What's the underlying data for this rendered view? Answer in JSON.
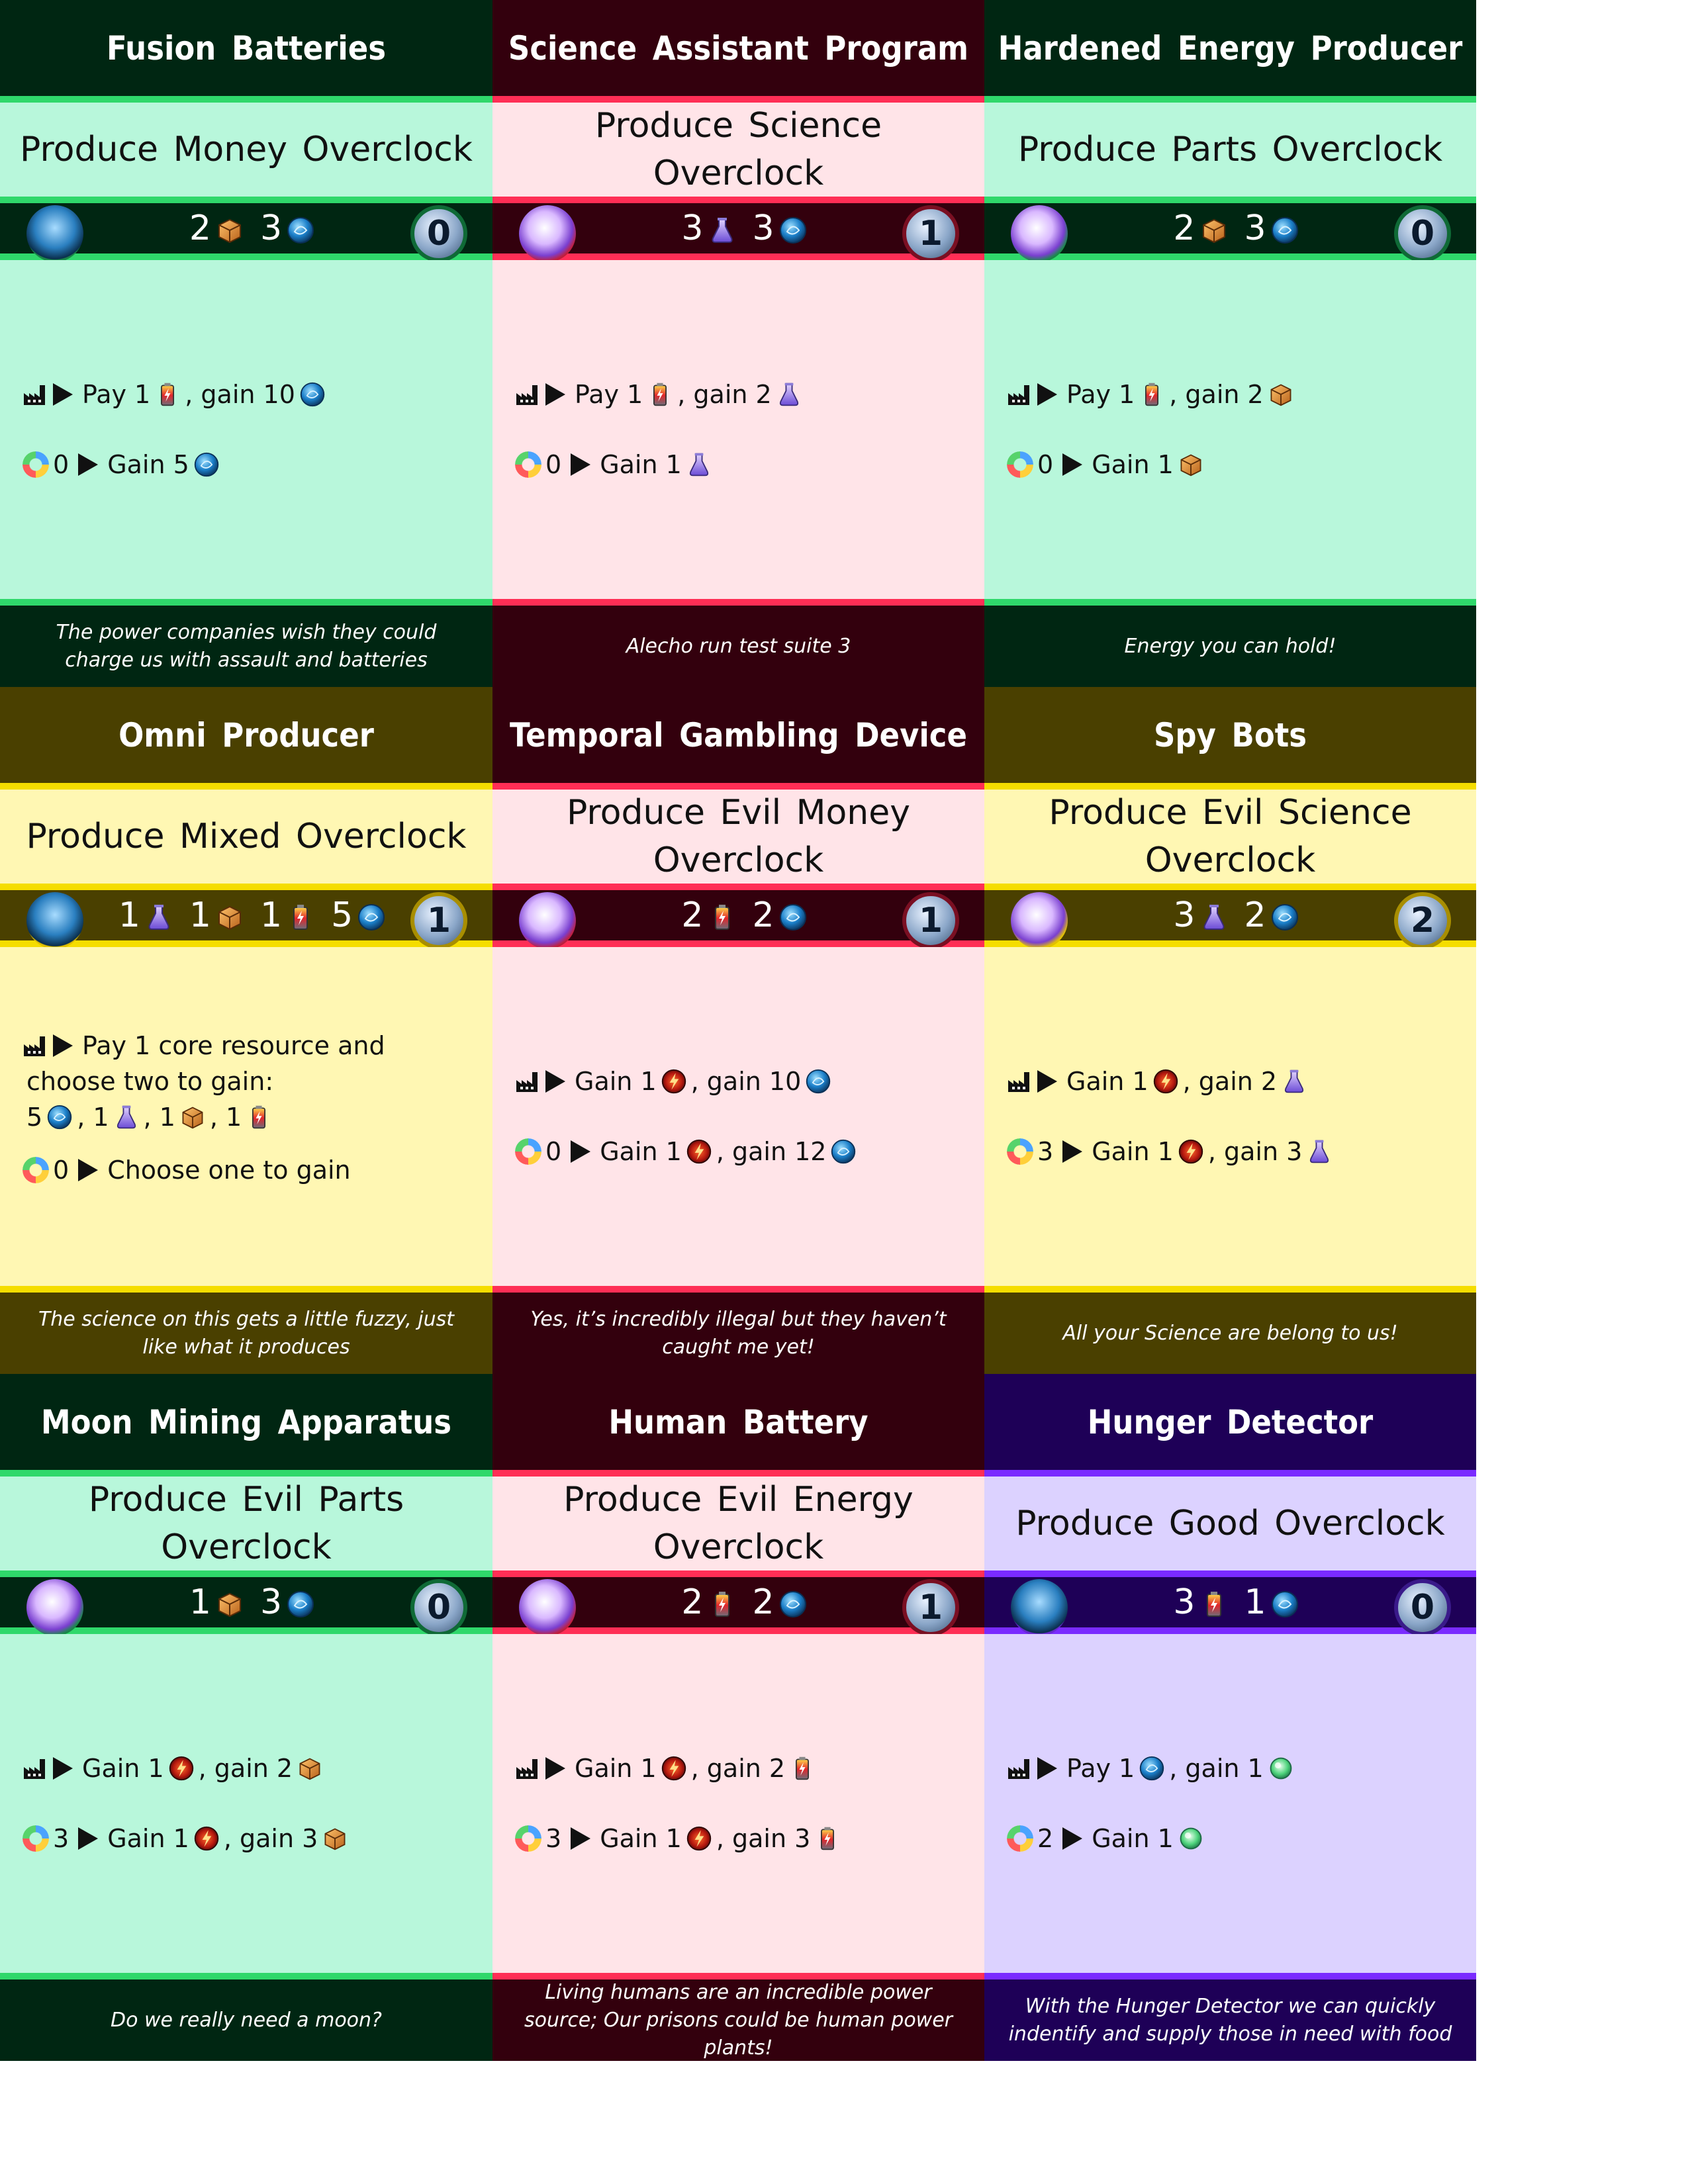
{
  "cards": [
    {
      "theme": "green",
      "title": "Fusion Batteries",
      "subtitle": "Produce Money Overclock",
      "portrait": "robot-portrait",
      "cost": [
        {
          "n": "2",
          "icon": "parts"
        },
        {
          "n": "3",
          "icon": "money"
        }
      ],
      "badge": "0",
      "lines": [
        [
          {
            "t": "factory"
          },
          {
            "t": "arrow"
          },
          {
            "s": "Pay 1"
          },
          {
            "t": "energy"
          },
          {
            "s": ", gain 10"
          },
          {
            "t": "money"
          }
        ],
        [
          {
            "t": "cycle"
          },
          {
            "s": "0"
          },
          {
            "t": "arrow"
          },
          {
            "s": "Gain 5"
          },
          {
            "t": "money"
          }
        ]
      ],
      "flavor": "The power companies wish they could charge us with assault and batteries"
    },
    {
      "theme": "red",
      "title": "Science Assistant Program",
      "subtitle": "Produce Science Overclock",
      "portrait": "cube-portrait",
      "cost": [
        {
          "n": "3",
          "icon": "science"
        },
        {
          "n": "3",
          "icon": "money"
        }
      ],
      "badge": "1",
      "lines": [
        [
          {
            "t": "factory"
          },
          {
            "t": "arrow"
          },
          {
            "s": "Pay 1"
          },
          {
            "t": "energy"
          },
          {
            "s": ", gain 2"
          },
          {
            "t": "science"
          }
        ],
        [
          {
            "t": "cycle"
          },
          {
            "s": "0"
          },
          {
            "t": "arrow"
          },
          {
            "s": "Gain 1"
          },
          {
            "t": "science"
          }
        ]
      ],
      "flavor": "Alecho run test suite 3"
    },
    {
      "theme": "green",
      "title": "Hardened Energy Producer",
      "subtitle": "Produce Parts Overclock",
      "portrait": "cube-portrait",
      "cost": [
        {
          "n": "2",
          "icon": "parts"
        },
        {
          "n": "3",
          "icon": "money"
        }
      ],
      "badge": "0",
      "lines": [
        [
          {
            "t": "factory"
          },
          {
            "t": "arrow"
          },
          {
            "s": "Pay 1"
          },
          {
            "t": "energy"
          },
          {
            "s": ", gain 2"
          },
          {
            "t": "parts"
          }
        ],
        [
          {
            "t": "cycle"
          },
          {
            "s": "0"
          },
          {
            "t": "arrow"
          },
          {
            "s": "Gain 1"
          },
          {
            "t": "parts"
          }
        ]
      ],
      "flavor": "Energy you can hold!"
    },
    {
      "theme": "yellow",
      "title": "Omni Producer",
      "subtitle": "Produce Mixed Overclock",
      "portrait": "robot-portrait",
      "cost": [
        {
          "n": "1",
          "icon": "science"
        },
        {
          "n": "1",
          "icon": "parts"
        },
        {
          "n": "1",
          "icon": "energy"
        },
        {
          "n": "5",
          "icon": "money"
        }
      ],
      "badge": "1",
      "lines": [
        [
          {
            "t": "factory"
          },
          {
            "t": "arrow"
          },
          {
            "s": "Pay 1 core resource and"
          }
        ],
        [
          {
            "s": "choose two to gain:"
          }
        ],
        [
          {
            "s": "5"
          },
          {
            "t": "money"
          },
          {
            "s": ", 1"
          },
          {
            "t": "science"
          },
          {
            "s": ", 1"
          },
          {
            "t": "parts"
          },
          {
            "s": ", 1"
          },
          {
            "t": "energy"
          }
        ],
        [
          {
            "t": "cycle"
          },
          {
            "s": "0"
          },
          {
            "t": "arrow"
          },
          {
            "s": "Choose one to gain"
          }
        ]
      ],
      "flavor": "The science on this gets a little fuzzy, just like what it produces"
    },
    {
      "theme": "red",
      "title": "Temporal Gambling Device",
      "subtitle": "Produce Evil Money Overclock",
      "portrait": "cube-portrait",
      "cost": [
        {
          "n": "2",
          "icon": "energy"
        },
        {
          "n": "2",
          "icon": "money"
        }
      ],
      "badge": "1",
      "lines": [
        [
          {
            "t": "factory"
          },
          {
            "t": "arrow"
          },
          {
            "s": "Gain 1"
          },
          {
            "t": "evil"
          },
          {
            "s": ", gain 10"
          },
          {
            "t": "money"
          }
        ],
        [
          {
            "t": "cycle"
          },
          {
            "s": "0"
          },
          {
            "t": "arrow"
          },
          {
            "s": "Gain 1"
          },
          {
            "t": "evil"
          },
          {
            "s": ", gain 12"
          },
          {
            "t": "money"
          }
        ]
      ],
      "flavor": "Yes, it’s incredibly illegal but they haven’t caught me yet!"
    },
    {
      "theme": "yellow",
      "title": "Spy Bots",
      "subtitle": "Produce Evil Science Overclock",
      "portrait": "cube-portrait",
      "cost": [
        {
          "n": "3",
          "icon": "science"
        },
        {
          "n": "2",
          "icon": "money"
        }
      ],
      "badge": "2",
      "lines": [
        [
          {
            "t": "factory"
          },
          {
            "t": "arrow"
          },
          {
            "s": "Gain 1"
          },
          {
            "t": "evil"
          },
          {
            "s": ", gain 2"
          },
          {
            "t": "science"
          }
        ],
        [
          {
            "t": "cycle"
          },
          {
            "s": "3"
          },
          {
            "t": "arrow"
          },
          {
            "s": "Gain 1"
          },
          {
            "t": "evil"
          },
          {
            "s": ", gain 3"
          },
          {
            "t": "science"
          }
        ]
      ],
      "flavor": "All your Science are belong to us!"
    },
    {
      "theme": "green",
      "title": "Moon Mining Apparatus",
      "subtitle": "Produce Evil Parts Overclock",
      "portrait": "cube-portrait",
      "cost": [
        {
          "n": "1",
          "icon": "parts"
        },
        {
          "n": "3",
          "icon": "money"
        }
      ],
      "badge": "0",
      "lines": [
        [
          {
            "t": "factory"
          },
          {
            "t": "arrow"
          },
          {
            "s": "Gain 1"
          },
          {
            "t": "evil"
          },
          {
            "s": ", gain 2"
          },
          {
            "t": "parts"
          }
        ],
        [
          {
            "t": "cycle"
          },
          {
            "s": "3"
          },
          {
            "t": "arrow"
          },
          {
            "s": "Gain 1"
          },
          {
            "t": "evil"
          },
          {
            "s": ", gain 3"
          },
          {
            "t": "parts"
          }
        ]
      ],
      "flavor": "Do we really need a moon?"
    },
    {
      "theme": "red",
      "title": "Human Battery",
      "subtitle": "Produce Evil Energy Overclock",
      "portrait": "cube-portrait",
      "cost": [
        {
          "n": "2",
          "icon": "energy"
        },
        {
          "n": "2",
          "icon": "money"
        }
      ],
      "badge": "1",
      "lines": [
        [
          {
            "t": "factory"
          },
          {
            "t": "arrow"
          },
          {
            "s": "Gain 1"
          },
          {
            "t": "evil"
          },
          {
            "s": ", gain 2"
          },
          {
            "t": "energy"
          }
        ],
        [
          {
            "t": "cycle"
          },
          {
            "s": "3"
          },
          {
            "t": "arrow"
          },
          {
            "s": "Gain 1"
          },
          {
            "t": "evil"
          },
          {
            "s": ", gain 3"
          },
          {
            "t": "energy"
          }
        ]
      ],
      "flavor": "Living humans are an incredible power source; Our prisons could be human power plants!"
    },
    {
      "theme": "purple",
      "title": "Hunger Detector",
      "subtitle": "Produce Good Overclock",
      "portrait": "robot-portrait",
      "cost": [
        {
          "n": "3",
          "icon": "energy"
        },
        {
          "n": "1",
          "icon": "money"
        }
      ],
      "badge": "0",
      "lines": [
        [
          {
            "t": "factory"
          },
          {
            "t": "arrow"
          },
          {
            "s": "Pay 1"
          },
          {
            "t": "money"
          },
          {
            "s": ", gain 1"
          },
          {
            "t": "good"
          }
        ],
        [
          {
            "t": "cycle"
          },
          {
            "s": "2"
          },
          {
            "t": "arrow"
          },
          {
            "s": "Gain 1"
          },
          {
            "t": "good"
          }
        ]
      ],
      "flavor": "With the Hunger Detector we can quickly indentify and supply those in need with food"
    }
  ]
}
